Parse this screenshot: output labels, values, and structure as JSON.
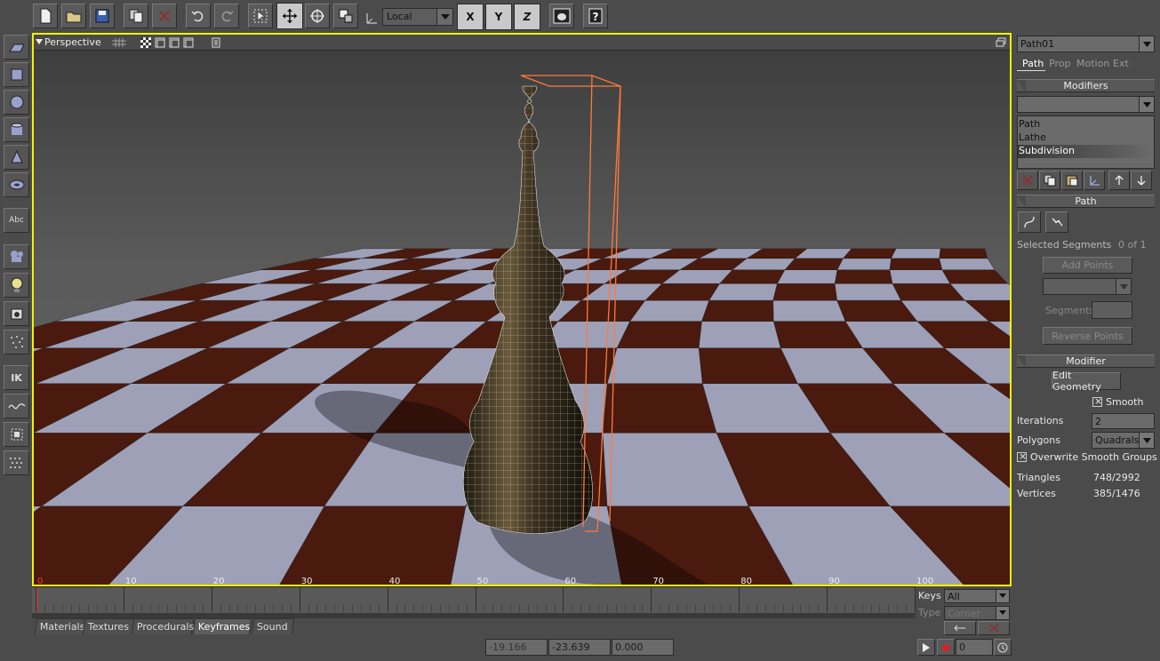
{
  "toolbar": {
    "coord_system": "Local",
    "axes": [
      "X",
      "Y",
      "Z"
    ]
  },
  "left_toolbar": {
    "text_tool": "Abc",
    "ik_tool": "IK"
  },
  "viewport": {
    "title": "Perspective"
  },
  "timeline": {
    "ticks": [
      "0",
      "10",
      "20",
      "30",
      "40",
      "50",
      "60",
      "70",
      "80",
      "90",
      "100"
    ],
    "keys_label": "Keys",
    "keys_value": "All",
    "type_label": "Type",
    "type_value": "Corner",
    "frame": "0"
  },
  "bottom_tabs": [
    "Materials",
    "Textures",
    "Procedurals",
    "Keyframes",
    "Sound"
  ],
  "coords": {
    "x": "-19.166",
    "y": "-23.639",
    "z": "0.000"
  },
  "right_panel": {
    "object_name": "Path01",
    "tabs": [
      "Path",
      "Prop",
      "Motion",
      "Ext"
    ],
    "modifiers_header": "Modifiers",
    "modifier_list": [
      "Path",
      "Lathe",
      "Subdivision"
    ],
    "path_header": "Path",
    "selected_segments_label": "Selected Segments",
    "selected_segments_value": "0 of 1",
    "add_points": "Add Points",
    "segments_label": "Segments",
    "reverse_points": "Reverse Points",
    "modifier_header": "Modifier",
    "edit_geometry": "Edit Geometry",
    "smooth_label": "Smooth",
    "iterations_label": "Iterations",
    "iterations_value": "2",
    "polygons_label": "Polygons",
    "polygons_value": "Quadrals",
    "overwrite_label": "Overwrite Smooth Groups",
    "triangles_label": "Triangles",
    "triangles_value": "748/2992",
    "vertices_label": "Vertices",
    "vertices_value": "385/1476"
  },
  "colors": {
    "viewport_border": "#f2f200",
    "bounding_box": "#ff7a3a",
    "board_dark": "#4a1a0e",
    "board_light": "#9ea0b8"
  }
}
